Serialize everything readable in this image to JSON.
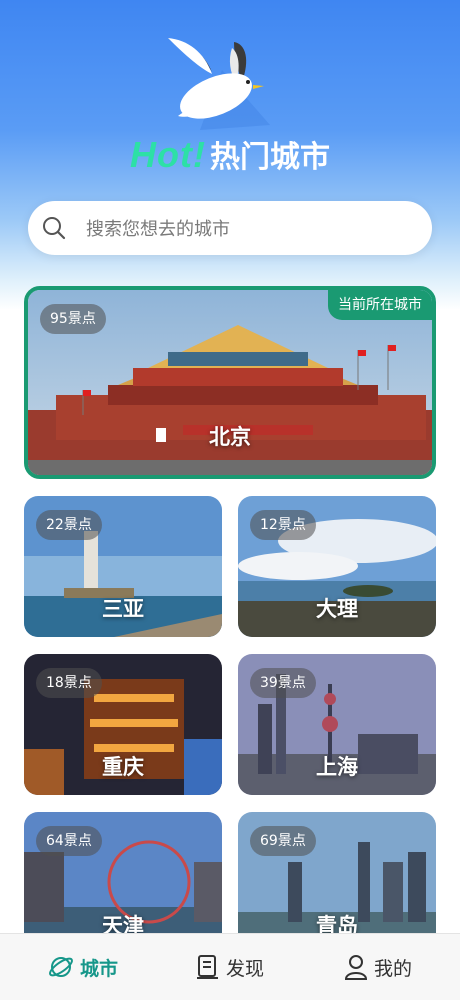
{
  "header": {
    "hot": "Hot!",
    "title": "热门城市"
  },
  "search": {
    "placeholder": "搜索您想去的城市"
  },
  "featured": {
    "spots": "95景点",
    "current_tag": "当前所在城市",
    "name": "北京"
  },
  "cities": [
    {
      "spots": "22景点",
      "name": "三亚"
    },
    {
      "spots": "12景点",
      "name": "大理"
    },
    {
      "spots": "18景点",
      "name": "重庆"
    },
    {
      "spots": "39景点",
      "name": "上海"
    },
    {
      "spots": "64景点",
      "name": "天津"
    },
    {
      "spots": "69景点",
      "name": "青岛"
    }
  ],
  "tabbar": {
    "items": [
      {
        "label": "城市",
        "icon": "planet-icon",
        "active": true
      },
      {
        "label": "发现",
        "icon": "document-icon",
        "active": false
      },
      {
        "label": "我的",
        "icon": "person-icon",
        "active": false
      }
    ]
  },
  "colors": {
    "accent": "#1a9a72",
    "tab_active": "#16978a",
    "hot": "#2de0a6"
  }
}
